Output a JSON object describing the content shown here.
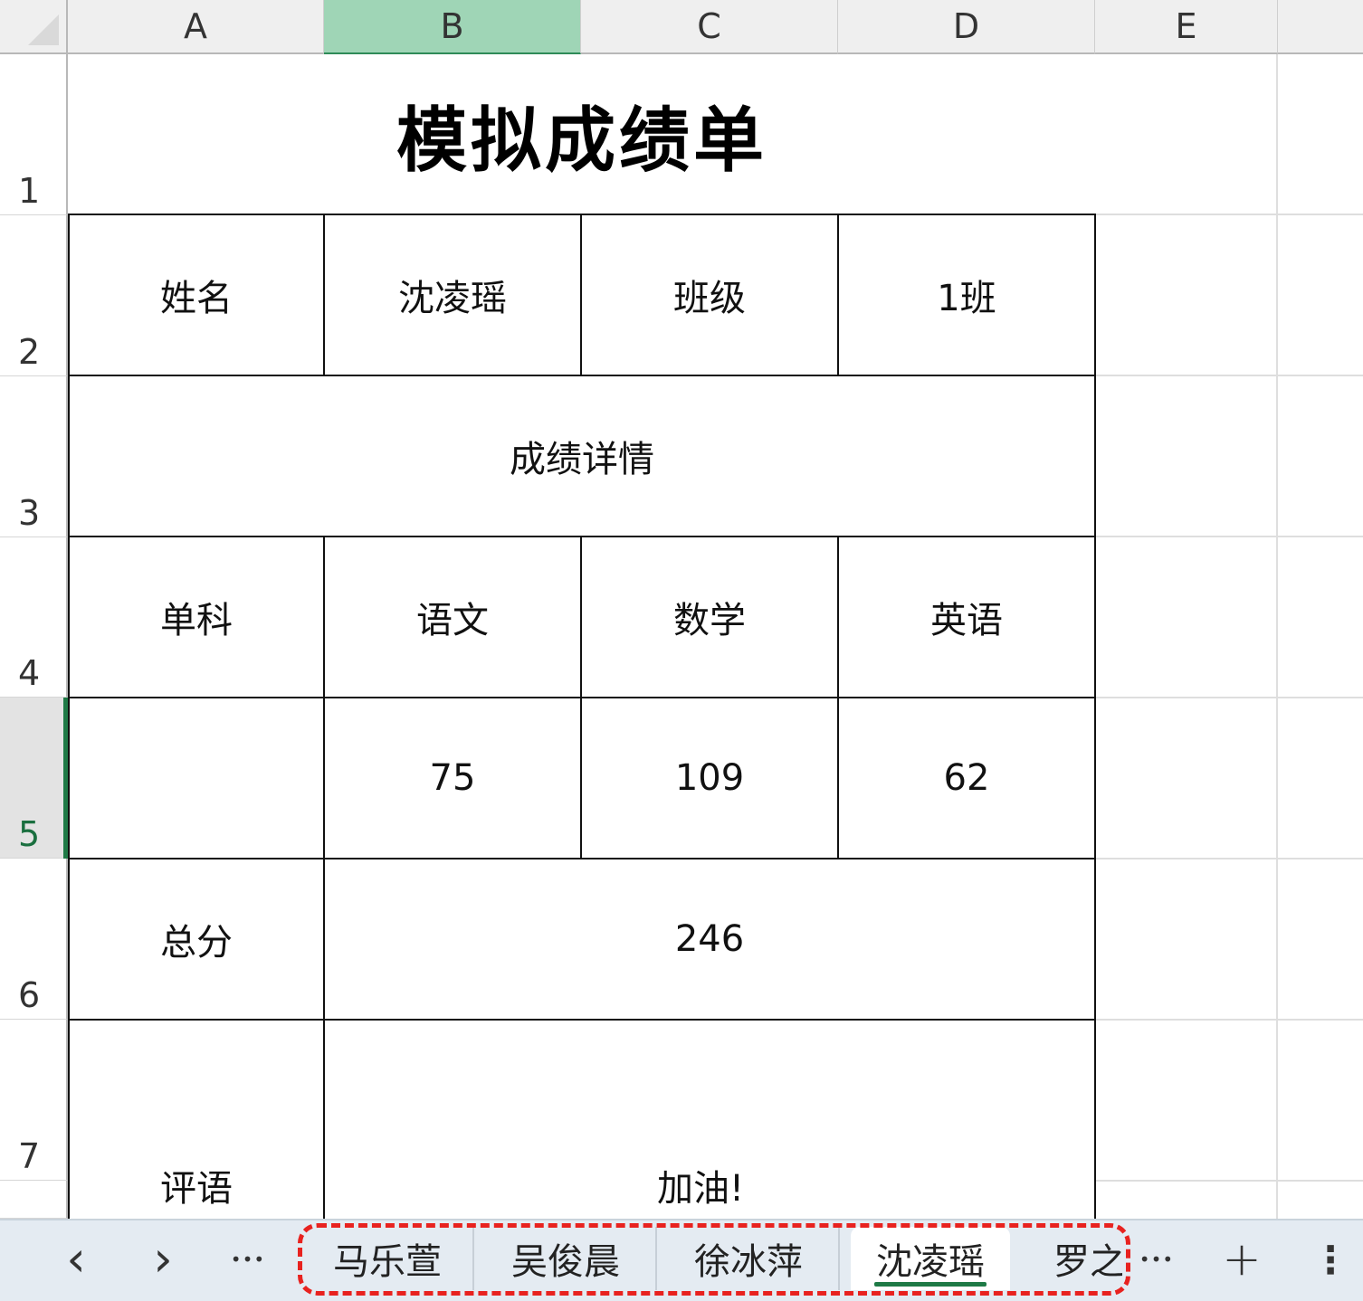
{
  "columns": [
    "A",
    "B",
    "C",
    "D",
    "E"
  ],
  "rows": [
    "1",
    "2",
    "3",
    "4",
    "5",
    "6",
    "7"
  ],
  "sheet": {
    "title": "模拟成绩单",
    "name_label": "姓名",
    "name_value": "沈凌瑶",
    "class_label": "班级",
    "class_value": "1班",
    "details_header": "成绩详情",
    "subject_label": "单科",
    "subjects": [
      "语文",
      "数学",
      "英语"
    ],
    "scores": [
      "75",
      "109",
      "62"
    ],
    "total_label": "总分",
    "total_value": "246",
    "comment_label": "评语",
    "comment_value": "加油!"
  },
  "selection": {
    "column": "B",
    "row": "5"
  },
  "tabs": {
    "prev_icon": "chevron-left-icon",
    "next_icon": "chevron-right-icon",
    "prev_symbol": "‹",
    "next_symbol": "›",
    "more_symbol": "•••",
    "add_symbol": "+",
    "menu_symbol": "⋮",
    "items": [
      "马乐萱",
      "吴俊晨",
      "徐冰萍",
      "沈凌瑶",
      "罗之"
    ],
    "active_index": 3
  },
  "colors": {
    "accent": "#1f7a46",
    "selected_header": "#9fd5b6",
    "highlight_dash": "#e8221f"
  }
}
